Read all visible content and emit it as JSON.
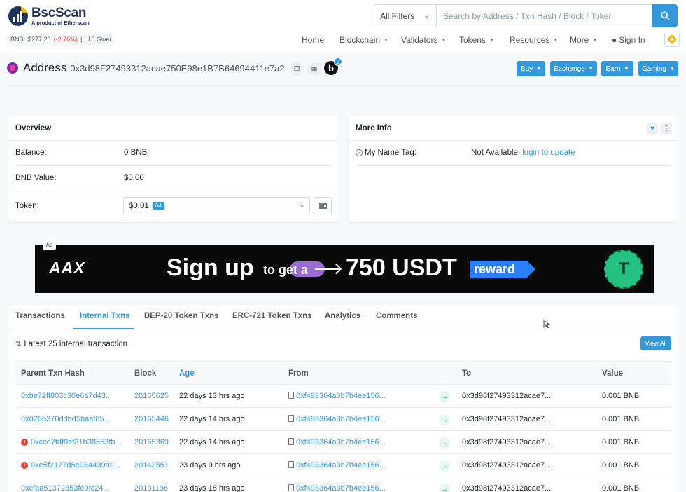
{
  "brand": {
    "name": "BscScan",
    "tagline": "A product of Etherscan"
  },
  "price": {
    "label": "BNB:",
    "value": "$277.26",
    "change": "(-2.76%)",
    "sep": "|",
    "gas": "5 Gwei"
  },
  "search": {
    "filter": "All Filters",
    "placeholder": "Search by Address / Txn Hash / Block / Token"
  },
  "nav": {
    "home": "Home",
    "blockchain": "Blockchain",
    "validators": "Validators",
    "tokens": "Tokens",
    "resources": "Resources",
    "more": "More",
    "signin": "Sign In"
  },
  "address": {
    "label": "Address",
    "hash": "0x3d98F27493312acae750E98e1B7B64694411e7a2",
    "badge": "b",
    "badge_count": "2"
  },
  "actions": {
    "buy": "Buy",
    "exchange": "Exchange",
    "earn": "Earn",
    "gaming": "Gaming"
  },
  "overview": {
    "title": "Overview",
    "balance_label": "Balance:",
    "balance": "0 BNB",
    "value_label": "BNB Value:",
    "value": "$0.00",
    "token_label": "Token:",
    "token_value": "$0.01",
    "token_count": "64"
  },
  "more_info": {
    "title": "More Info",
    "name_tag_label": "My Name Tag:",
    "name_tag_value": "Not Available,",
    "name_tag_link": "login to update"
  },
  "banner": {
    "ad": "Ad",
    "brand": "AAX",
    "headline": "Sign up",
    "to_get": "to get a",
    "amount": "750 USDT",
    "reward": "reward",
    "coin": "T"
  },
  "tabs": [
    "Transactions",
    "Internal Txns",
    "BEP-20 Token Txns",
    "ERC-721 Token Txns",
    "Analytics",
    "Comments"
  ],
  "list": {
    "summary": "Latest 25 internal transaction",
    "view_all": "View All"
  },
  "table": {
    "headers": [
      "Parent Txn Hash",
      "Block",
      "Age",
      "From",
      "To",
      "Value"
    ],
    "rows": [
      {
        "hash": "0xbe72ff803c30e6a7d43...",
        "block": "20165625",
        "age": "22 days 13 hrs ago",
        "from": "0xf493364a3b7b4ee156...",
        "to": "0x3d98f27493312acae7...",
        "value": "0.001 BNB",
        "error": false
      },
      {
        "hash": "0x026b370ddbd5baaf85...",
        "block": "20165446",
        "age": "22 days 14 hrs ago",
        "from": "0xf493364a3b7b4ee156...",
        "to": "0x3d98f27493312acae7...",
        "value": "0.001 BNB",
        "error": false
      },
      {
        "hash": "0xcce7fdf9ef31b38553fb...",
        "block": "20165369",
        "age": "22 days 14 hrs ago",
        "from": "0xf493364a3b7b4ee156...",
        "to": "0x3d98f27493312acae7...",
        "value": "0.001 BNB",
        "error": true
      },
      {
        "hash": "0xe5f2177d5e964439b9...",
        "block": "20142551",
        "age": "23 days 9 hrs ago",
        "from": "0xf493364a3b7b4ee156...",
        "to": "0x3d98f27493312acae7...",
        "value": "0.001 BNB",
        "error": true
      },
      {
        "hash": "0xcfaa51372353fe0fc24...",
        "block": "20131196",
        "age": "23 days 18 hrs ago",
        "from": "0xf493364a3b7b4ee156...",
        "to": "0x3d98f27493312acae7...",
        "value": "0.001 BNB",
        "error": false
      }
    ]
  },
  "colors": {
    "accent": "#3498db",
    "brand_navy": "#21325b",
    "bnb_gold": "#f0b90b",
    "negative": "#de4437",
    "success": "#00a186"
  }
}
